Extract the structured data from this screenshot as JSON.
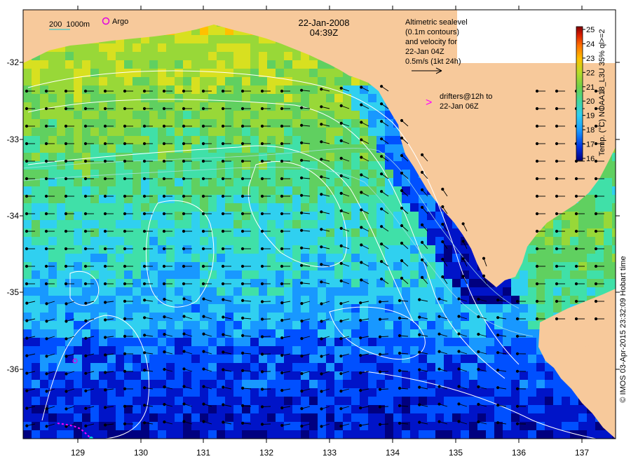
{
  "map": {
    "date": "22-Jan-2008",
    "time": "04:39Z",
    "legend_depth": "200  1000m",
    "legend_argo": "Argo",
    "altimetry_lines": [
      "Altimetric sealevel",
      "(0.1m contours)",
      "and velocity for",
      "22-Jan 04Z",
      "0.5m/s (1kt 24h)"
    ],
    "drifters_lines": [
      "drifters@12h to",
      "22-Jan 06Z"
    ],
    "drifter_symbol": ">",
    "colorbar_title": "Temp. (°C) NOAA18_L3U 35% ql>=2",
    "copyright": "© IMOS 03-Apr-2015 23:32:09 Hobart time",
    "x_ticks": [
      "129",
      "130",
      "131",
      "132",
      "133",
      "134",
      "135",
      "136",
      "137"
    ],
    "y_ticks": [
      "-32",
      "-33",
      "-34",
      "-35",
      "-36"
    ],
    "colorbar_ticks": [
      "25",
      "24",
      "23",
      "22",
      "21",
      "20",
      "19",
      "18",
      "17",
      "16"
    ],
    "colors": {
      "land": "#f7c99b",
      "argo": "#e000e0",
      "drifter": "#ff00ff",
      "contour": "#ffffff",
      "depth_contour": "#a8e0e8",
      "scale_cmap": [
        "#000080",
        "#0014c8",
        "#0050ff",
        "#1898ff",
        "#30d0f0",
        "#40e0a8",
        "#60d060",
        "#98d838",
        "#d8e020",
        "#ffc000",
        "#ff7000",
        "#e02000",
        "#800000"
      ]
    }
  }
}
